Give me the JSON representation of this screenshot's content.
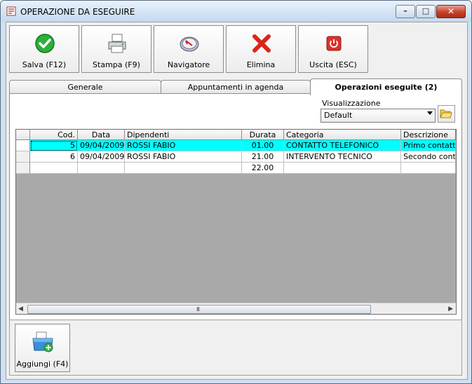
{
  "window": {
    "title": "OPERAZIONE DA ESEGUIRE"
  },
  "toolbar": {
    "buttons": [
      {
        "label": "Salva (F12)",
        "icon": "check-icon"
      },
      {
        "label": "Stampa (F9)",
        "icon": "printer-icon"
      },
      {
        "label": "Navigatore",
        "icon": "compass-icon"
      },
      {
        "label": "Elimina",
        "icon": "delete-x-icon"
      },
      {
        "label": "Uscita (ESC)",
        "icon": "power-icon"
      }
    ]
  },
  "tabs": [
    {
      "label": "Generale",
      "active": false
    },
    {
      "label": "Appuntamenti in agenda",
      "active": false
    },
    {
      "label": "Operazioni eseguite (2)",
      "active": true
    }
  ],
  "visualizzazione": {
    "label": "Visualizzazione",
    "selected": "Default"
  },
  "table": {
    "columns": [
      "Cod.",
      "Data",
      "Dipendenti",
      "Durata",
      "Categoria",
      "Descrizione"
    ],
    "rows": [
      {
        "cod": "5",
        "data": "09/04/2009",
        "dipendenti": "ROSSI FABIO",
        "durata": "01.00",
        "categoria": "CONTATTO TELEFONICO",
        "descrizione": "Primo contatto p",
        "selected": true
      },
      {
        "cod": "6",
        "data": "09/04/2009",
        "dipendenti": "ROSSI FABIO",
        "durata": "21.00",
        "categoria": "INTERVENTO TECNICO",
        "descrizione": "Secondo conta",
        "selected": false
      }
    ],
    "total": {
      "durata": "22.00"
    },
    "scrollbar_grip": "III"
  },
  "bottom": {
    "add_label": "Aggiungi (F4)"
  },
  "colors": {
    "selected_row": "#00ffff",
    "grid_background": "#a9a9a9",
    "close_button": "#c8402a"
  }
}
